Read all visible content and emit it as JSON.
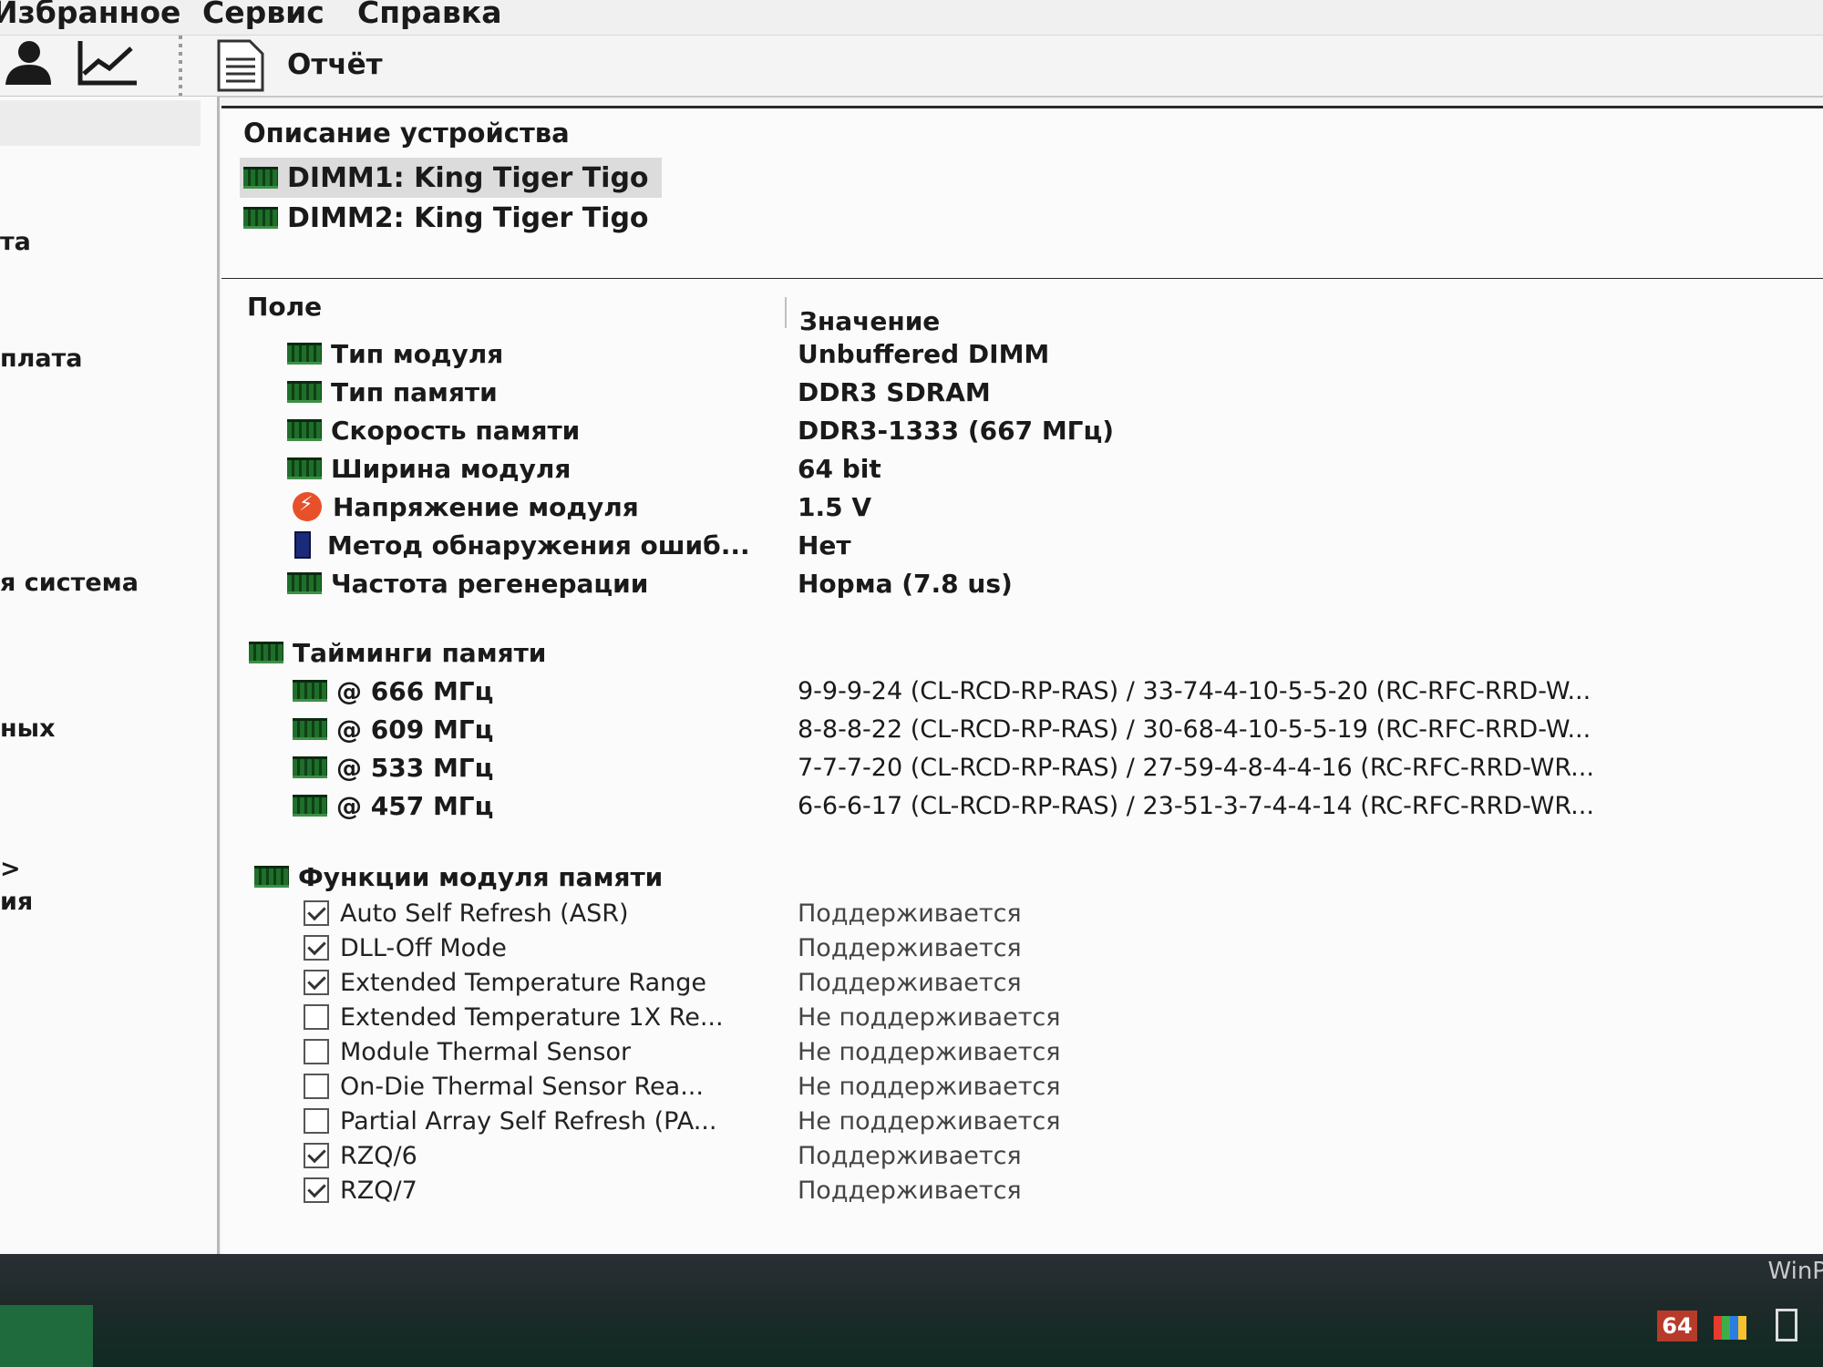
{
  "menu": {
    "items": [
      "Избранное",
      "Сервис",
      "Справка"
    ]
  },
  "toolbar": {
    "icons": [
      "user-icon",
      "chart-icon",
      "report-icon"
    ],
    "report_label": "Отчёт"
  },
  "left_pane": {
    "items": [
      "та",
      "плата",
      "я система",
      "ных",
      ">",
      "ия"
    ]
  },
  "device_pane": {
    "title": "Описание устройства",
    "devices": [
      {
        "label": "DIMM1: King Tiger Tigo",
        "selected": true
      },
      {
        "label": "DIMM2: King Tiger Tigo",
        "selected": false
      }
    ]
  },
  "fields": {
    "col_field": "Поле",
    "col_value": "Значение",
    "module": [
      {
        "field": "Тип модуля",
        "value": "Unbuffered DIMM",
        "icon": "memory-icon"
      },
      {
        "field": "Тип памяти",
        "value": "DDR3 SDRAM",
        "icon": "memory-icon"
      },
      {
        "field": "Скорость памяти",
        "value": "DDR3-1333 (667 МГц)",
        "icon": "memory-icon"
      },
      {
        "field": "Ширина модуля",
        "value": "64 bit",
        "icon": "memory-icon"
      },
      {
        "field": "Напряжение модуля",
        "value": "1.5 V",
        "icon": "voltage-icon"
      },
      {
        "field": "Метод обнаружения ошиб...",
        "value": "Нет",
        "icon": "ecc-icon"
      },
      {
        "field": "Частота регенерации",
        "value": "Норма (7.8 us)",
        "icon": "memory-icon"
      }
    ],
    "timings_title": "Тайминги памяти",
    "timings": [
      {
        "field": "@ 666 МГц",
        "value": "9-9-9-24  (CL-RCD-RP-RAS) / 33-74-4-10-5-5-20  (RC-RFC-RRD-W..."
      },
      {
        "field": "@ 609 МГц",
        "value": "8-8-8-22  (CL-RCD-RP-RAS) / 30-68-4-10-5-5-19  (RC-RFC-RRD-W..."
      },
      {
        "field": "@ 533 МГц",
        "value": "7-7-7-20  (CL-RCD-RP-RAS) / 27-59-4-8-4-4-16  (RC-RFC-RRD-WR..."
      },
      {
        "field": "@ 457 МГц",
        "value": "6-6-6-17  (CL-RCD-RP-RAS) / 23-51-3-7-4-4-14  (RC-RFC-RRD-WR..."
      }
    ],
    "features_title": "Функции модуля памяти",
    "features": [
      {
        "field": "Auto Self Refresh (ASR)",
        "value": "Поддерживается",
        "checked": true
      },
      {
        "field": "DLL-Off Mode",
        "value": "Поддерживается",
        "checked": true
      },
      {
        "field": "Extended Temperature Range",
        "value": "Поддерживается",
        "checked": true
      },
      {
        "field": "Extended Temperature 1X Re...",
        "value": "Не поддерживается",
        "checked": false
      },
      {
        "field": "Module Thermal Sensor",
        "value": "Не поддерживается",
        "checked": false
      },
      {
        "field": "On-Die Thermal Sensor Rea...",
        "value": "Не поддерживается",
        "checked": false
      },
      {
        "field": "Partial Array Self Refresh (PA...",
        "value": "Не поддерживается",
        "checked": false
      },
      {
        "field": "RZQ/6",
        "value": "Поддерживается",
        "checked": true
      },
      {
        "field": "RZQ/7",
        "value": "Поддерживается",
        "checked": true
      }
    ]
  },
  "taskbar": {
    "winp": "WinP",
    "badge": "64"
  },
  "colors": {
    "memory_icon": "#1f6f2a",
    "voltage_icon": "#e8502a",
    "ecc_icon": "#1c2a7a",
    "taskbar": "#1f2a2a"
  }
}
